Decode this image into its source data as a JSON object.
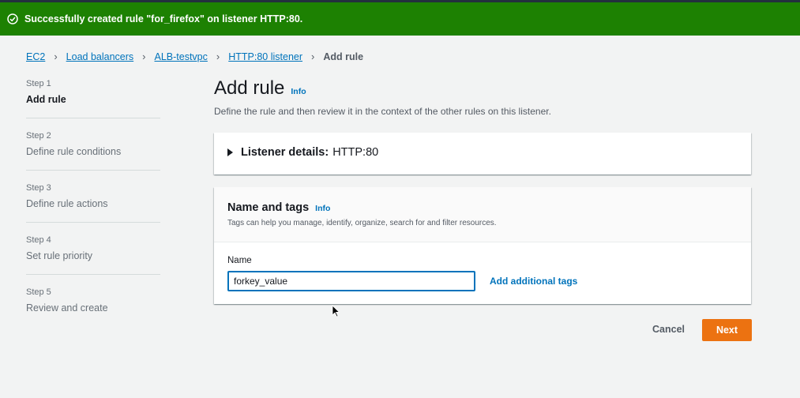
{
  "flash": {
    "message": "Successfully created rule \"for_firefox\" on listener HTTP:80.",
    "icon": "check-circle-icon",
    "color": "#1d8102"
  },
  "breadcrumb": {
    "items": [
      "EC2",
      "Load balancers",
      "ALB-testvpc",
      "HTTP:80 listener"
    ],
    "current": "Add rule"
  },
  "steps": [
    {
      "num": "Step 1",
      "label": "Add rule"
    },
    {
      "num": "Step 2",
      "label": "Define rule conditions"
    },
    {
      "num": "Step 3",
      "label": "Define rule actions"
    },
    {
      "num": "Step 4",
      "label": "Set rule priority"
    },
    {
      "num": "Step 5",
      "label": "Review and create"
    }
  ],
  "page": {
    "title": "Add rule",
    "info": "Info",
    "subtitle": "Define the rule and then review it in the context of the other rules on this listener."
  },
  "listener": {
    "label": "Listener details:",
    "value": "HTTP:80"
  },
  "tags": {
    "title": "Name and tags",
    "info": "Info",
    "description": "Tags can help you manage, identify, organize, search for and filter resources.",
    "name_label": "Name",
    "name_value": "forkey_value",
    "add_tags": "Add additional tags"
  },
  "actions": {
    "cancel": "Cancel",
    "next": "Next"
  },
  "colors": {
    "accent": "#0073bb",
    "primary_button": "#ec7211"
  }
}
